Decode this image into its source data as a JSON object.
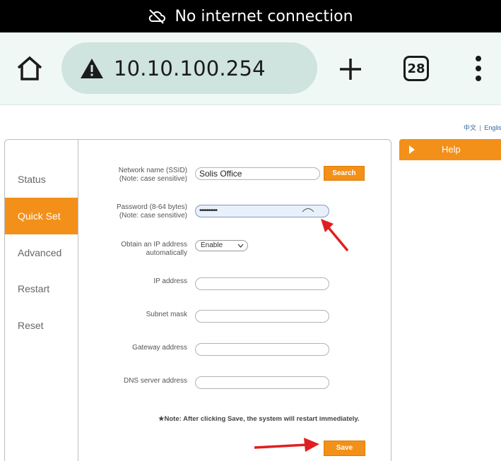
{
  "status_bar": {
    "message": "No internet connection",
    "icon": "cloud-off-icon"
  },
  "browser": {
    "url": "10.10.100.254",
    "tab_count": "28",
    "icons": [
      "home-icon",
      "warning-icon",
      "plus-icon",
      "tabs-icon",
      "more-vert-icon"
    ]
  },
  "page": {
    "lang": {
      "chinese": "中文",
      "separator": "|",
      "english": "Englis"
    },
    "sidebar": {
      "items": [
        {
          "label": "Status"
        },
        {
          "label": "Quick Set"
        },
        {
          "label": "Advanced"
        },
        {
          "label": "Restart"
        },
        {
          "label": "Reset"
        }
      ],
      "active": "Quick Set"
    },
    "form": {
      "ssid": {
        "label_line1": "Network name (SSID)",
        "label_line2": "(Note: case sensitive)",
        "value": "Solis Office",
        "search_label": "Search"
      },
      "password": {
        "label_line1": "Password (8-64 bytes)",
        "label_line2": "(Note: case sensitive)",
        "value": "••••••••••"
      },
      "obtain_ip": {
        "label_line1": "Obtain an IP address",
        "label_line2": "automatically",
        "selected": "Enable"
      },
      "ip_address": {
        "label": "IP address",
        "value": ""
      },
      "subnet_mask": {
        "label": "Subnet mask",
        "value": ""
      },
      "gateway": {
        "label": "Gateway address",
        "value": ""
      },
      "dns": {
        "label": "DNS server address",
        "value": ""
      },
      "note": "★Note: After clicking Save, the system will restart immediately.",
      "save_label": "Save"
    },
    "help": {
      "label": "Help"
    },
    "colors": {
      "accent": "#f39019",
      "status_bar": "#000000",
      "toolbar": "#f0f8f6",
      "urlbar": "#cfe3df",
      "annotation": "#e02020"
    }
  }
}
